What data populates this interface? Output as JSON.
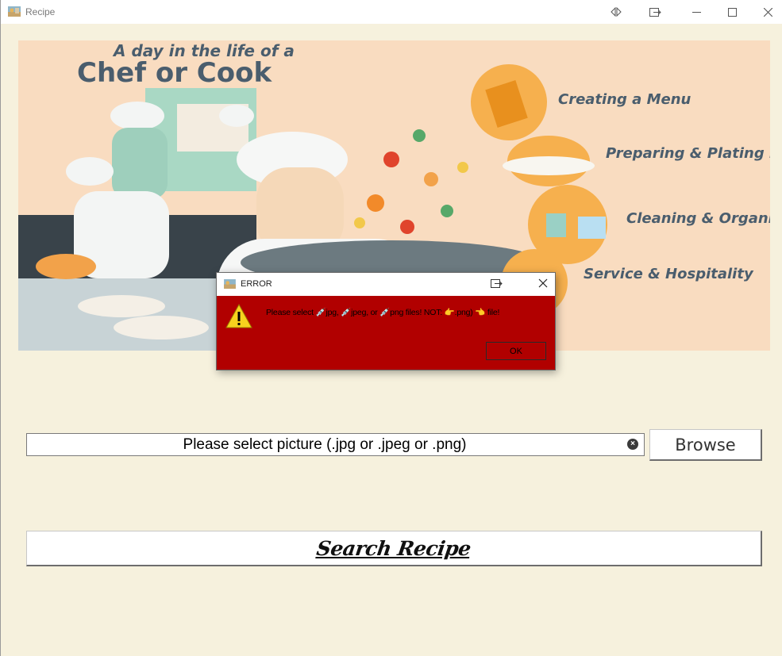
{
  "window": {
    "title": "Recipe",
    "controls": [
      "split-view-icon",
      "pin-icon",
      "minimize-icon",
      "maximize-icon",
      "close-icon"
    ]
  },
  "banner": {
    "subtitle": "A day in the life of a",
    "title": "Chef or Cook",
    "tasks": [
      "Creating a Menu",
      "Preparing & Plating Food",
      "Cleaning & Organizing",
      "Service & Hospitality"
    ]
  },
  "file_input": {
    "placeholder": "Please select picture (.jpg or .jpeg or .png)",
    "value": "",
    "clear_icon": "clear-icon"
  },
  "browse_button": {
    "label": "Browse"
  },
  "search_button": {
    "label": "Search Recipe"
  },
  "error_dialog": {
    "title": "ERROR",
    "message": "Please select 💉jpg, 💉jpeg, or 💉png files! NOT: 👉.png) 👈 file!",
    "ok_label": "OK",
    "icon": "warning-icon"
  },
  "colors": {
    "window_bg": "#f6f1dd",
    "dialog_bg": "#b10000",
    "banner_bg": "#f9dcc0",
    "title_blue": "#4a5d6d"
  }
}
